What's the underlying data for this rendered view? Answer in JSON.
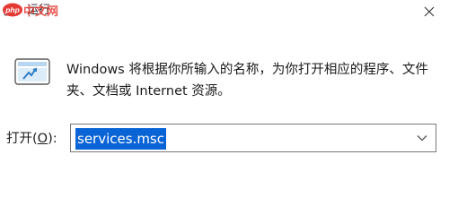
{
  "window": {
    "title": "运行",
    "icon": "run-app-icon",
    "close_icon": "close-icon"
  },
  "watermark": {
    "text": "php中文网",
    "colors": {
      "logo_bg": "#e53935",
      "text": "#e53935"
    }
  },
  "dialog": {
    "icon": "run-program-icon",
    "description": "Windows 将根据你所输入的名称，为你打开相应的程序、文件夹、文档或 Internet 资源。",
    "open_label_prefix": "打开(",
    "open_label_accel": "O",
    "open_label_suffix": "):",
    "command_value": "services.msc",
    "dropdown_icon": "chevron-down-icon"
  },
  "colors": {
    "selection": "#0a64d6",
    "border": "#7a7a7a",
    "background": "#ffffff"
  }
}
